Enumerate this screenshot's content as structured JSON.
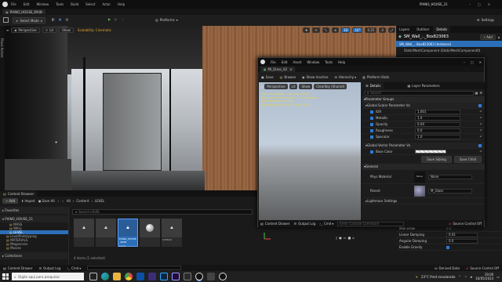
{
  "app": {
    "project_title": "PIANO_HOUSE_21",
    "menu": [
      "File",
      "Edit",
      "Window",
      "Tools",
      "Build",
      "Select",
      "Actor",
      "Help"
    ],
    "level_tab": "PIANO_HOUSE_MAIN",
    "select_mode": "Select Mode",
    "platforms": "Platforms",
    "settings": "Settings"
  },
  "viewport": {
    "perspective": "Perspective",
    "lit": "Lit",
    "show": "Show",
    "scalability": "Scalability: Cinematic",
    "grid_snap": "10",
    "rot_snap": "10°",
    "scale_snap": "0.25",
    "cam_speed": "4"
  },
  "left_strip": {
    "place_actors": "Place Actors"
  },
  "outliner": {
    "tabs": [
      "Layers",
      "Outliner",
      "Details"
    ],
    "title": "SM_Wall_.._Box823063",
    "add": "Add",
    "instance": "SM_Wall_...Box823063 (Instance)",
    "component": "StaticMeshComponent (StaticMeshComponent0)",
    "section_items": [
      "Max Draw",
      "Linear Damping",
      "Angular Damping",
      "Enable Gravity"
    ],
    "section_values": [
      "0.0",
      "0.01",
      "0.0",
      ""
    ]
  },
  "material_editor": {
    "menu": [
      "File",
      "Edit",
      "Asset",
      "Window",
      "Tools",
      "Help"
    ],
    "tab": "MI_Glass_02",
    "toolbar": [
      "Save",
      "Browse",
      "Show Inactive",
      "Hierarchy",
      "Platform Stats"
    ],
    "vp_perspective": "Perspective",
    "vp_lit": "Lit",
    "vp_show": "Show",
    "vp_sky": "ClearSky (Shared)",
    "stats": [
      "Base pass shader: 148 instructions",
      "Base pass vertex shader: 37 instructions",
      "Texture samplers: 0/16",
      "Texture Lookups (Est.): VS(0), PS(0)"
    ],
    "details_tab": "Details",
    "layer_tab": "Layer Parameters",
    "search_placeholder": "Search",
    "param_groups": "Parameter Groups",
    "scalar_group": "Global Scalar Parameter Va",
    "scalar_params": [
      {
        "name": "IOR",
        "value": "1.001",
        "checked": true
      },
      {
        "name": "Metallic",
        "value": "1.0",
        "checked": true
      },
      {
        "name": "Opacity",
        "value": "0.04",
        "checked": true
      },
      {
        "name": "Roughness",
        "value": "0.0",
        "checked": true
      },
      {
        "name": "Specular",
        "value": "1.0",
        "checked": true
      }
    ],
    "vector_group": "Global Vector Parameter Va",
    "base_color": "Base Color",
    "save_sibling": "Save Sibling",
    "save_child": "Save Child",
    "general": "General",
    "phys_material": "Phys Material",
    "phys_none": "None",
    "phys_value": "None",
    "parent": "Parent",
    "parent_value": "M_Glass",
    "lightmass": "Lightmass Settings",
    "content_drawer": "Content Drawer",
    "output_log": "Output Log",
    "cmd": "Cmd",
    "console_placeholder": "Enter Console Command",
    "source_control": "Source Control Off"
  },
  "content_browser": {
    "tab": "Content Browser",
    "add": "Add",
    "import": "Import",
    "save_all": "Save All",
    "path": [
      "All",
      "Content",
      "LEVEL"
    ],
    "favorites": "Favorites",
    "root": "PIANO_HOUSE_21",
    "folders": [
      "MASS",
      "WALL",
      "LEVEL",
      "LevelPrototyping",
      "MATERIALS",
      "Megascans",
      "Movies"
    ],
    "search_placeholder": "Search LEVEL",
    "assets": [
      "",
      "",
      "PIANO_HOUSE_MAIN",
      "",
      "Untitled"
    ],
    "asset_sublabels": [
      "",
      "",
      "Level",
      "",
      ""
    ],
    "status": "4 items (1 selected)",
    "collections": "Collections"
  },
  "statusbar": {
    "content_drawer": "Content Drawer",
    "output_log": "Output Log",
    "cmd": "Cmd",
    "derived_data": "Derived Data",
    "source_control": "Source Control Off"
  },
  "taskbar": {
    "search_placeholder": "Digite aqui para pesquisar",
    "weather": "23°C  Pred ensolarado",
    "time": "19:00",
    "date": "16/05/2023"
  },
  "colors": {
    "accent": "#2c7bd6",
    "selected": "#2c6fb8",
    "panel": "#1c1c1c"
  }
}
